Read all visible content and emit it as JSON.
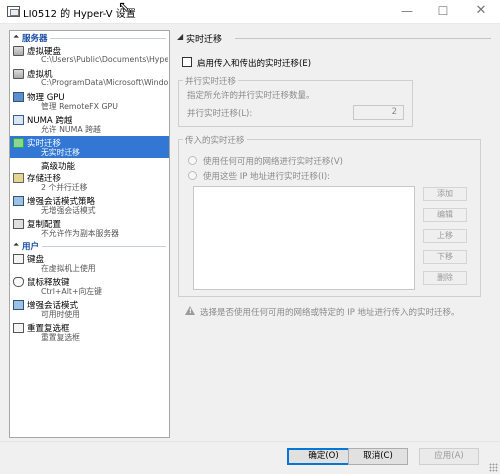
{
  "window": {
    "title": "LI0512 的 Hyper-V 设置",
    "buttons": {
      "minimize": "—",
      "maximize": "☐",
      "close": "✕"
    }
  },
  "sidebar": {
    "server_header": "服务器",
    "user_header": "用户",
    "items": [
      {
        "label": "虚拟硬盘",
        "sub": "C:\\Users\\Public\\Documents\\Hyper-...",
        "icon": "disk-icon"
      },
      {
        "label": "虚拟机",
        "sub": "C:\\ProgramData\\Microsoft\\Windo...",
        "icon": "vm-disk-icon"
      },
      {
        "label": "物理 GPU",
        "sub": "管理 RemoteFX GPU",
        "icon": "monitor-icon"
      },
      {
        "label": "NUMA 跨越",
        "sub": "允许 NUMA 跨越",
        "icon": "numa-icon"
      },
      {
        "label": "实时迁移",
        "sub": "无实时迁移",
        "icon": "live-migration-icon"
      },
      {
        "label": "高级功能",
        "sub": ""
      },
      {
        "label": "存储迁移",
        "sub": "2 个并行迁移",
        "icon": "storage-migration-icon"
      },
      {
        "label": "增强会话模式策略",
        "sub": "无增强会话模式",
        "icon": "session-policy-icon"
      },
      {
        "label": "复制配置",
        "sub": "不允许作为副本服务器",
        "icon": "replication-icon"
      },
      {
        "label": "键盘",
        "sub": "在虚拟机上使用",
        "icon": "keyboard-icon"
      },
      {
        "label": "鼠标释放键",
        "sub": "Ctrl+Alt+向左键",
        "icon": "mouse-icon"
      },
      {
        "label": "增强会话模式",
        "sub": "可用时使用",
        "icon": "session-icon"
      },
      {
        "label": "重置复选框",
        "sub": "重置复选框",
        "icon": "reset-checkbox-icon"
      }
    ]
  },
  "main": {
    "section_title": "实时迁移",
    "enable_checkbox_label": "启用传入和传出的实时迁移(E)",
    "enable_checked": false,
    "parallel_group": {
      "legend": "并行实时迁移",
      "description": "指定所允许的并行实时迁移数量。",
      "field_label": "并行实时迁移(L):",
      "value": "2"
    },
    "incoming_group": {
      "legend": "传入的实时迁移",
      "radio_any": "使用任何可用的网络进行实时迁移(V)",
      "radio_these": "使用这些 IP 地址进行实时迁移(I):",
      "buttons": [
        "添加",
        "编辑",
        "上移",
        "下移",
        "删除"
      ]
    },
    "info_text": "选择是否使用任何可用的网络或特定的 IP 地址进行传入的实时迁移。"
  },
  "footer": {
    "ok": "确定(O)",
    "cancel": "取消(C)",
    "apply": "应用(A)"
  }
}
